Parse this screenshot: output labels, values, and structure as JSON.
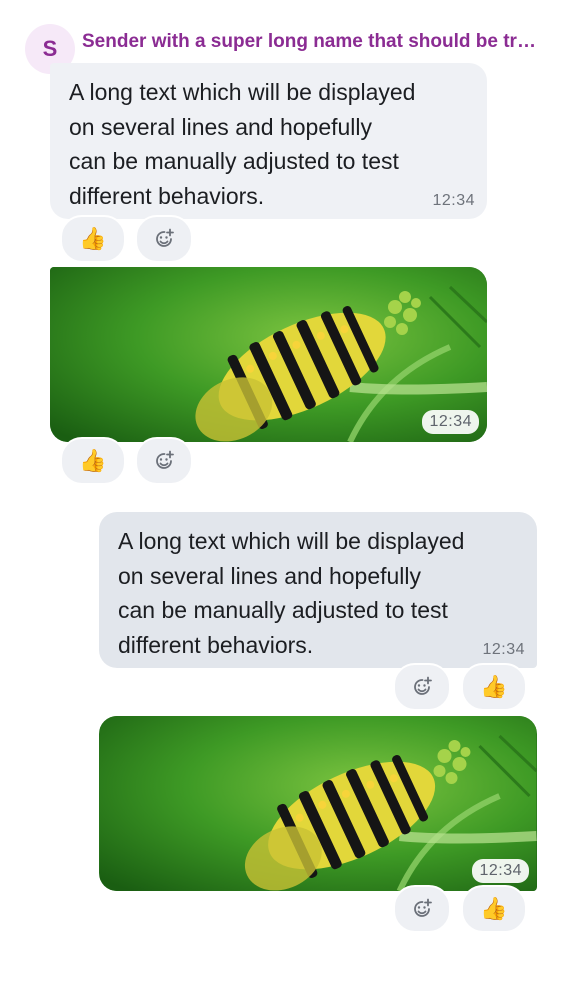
{
  "sender": {
    "initial": "S",
    "name": "Sender with a super long name that should be truncated"
  },
  "messages": [
    {
      "direction": "incoming",
      "type": "text",
      "lines": [
        "A long text which will be displayed",
        "on several lines and hopefully",
        "can be manually adjusted to test",
        "different behaviors."
      ],
      "time": "12:34",
      "reactions": [
        {
          "emoji": "👍"
        }
      ],
      "add_reaction_icon": "add-reaction-icon"
    },
    {
      "direction": "incoming",
      "type": "image",
      "image_subject": "caterpillar on plant",
      "time": "12:34",
      "reactions": [
        {
          "emoji": "👍"
        }
      ],
      "add_reaction_icon": "add-reaction-icon"
    },
    {
      "direction": "outgoing",
      "type": "text",
      "lines": [
        "A long text which will be displayed",
        "on several lines and hopefully",
        "can be manually adjusted to test",
        "different behaviors."
      ],
      "time": "12:34",
      "reactions": [
        {
          "emoji": "👍"
        }
      ],
      "add_reaction_icon": "add-reaction-icon"
    },
    {
      "direction": "outgoing",
      "type": "image",
      "image_subject": "caterpillar on plant",
      "time": "12:34",
      "reactions": [
        {
          "emoji": "👍"
        }
      ],
      "add_reaction_icon": "add-reaction-icon"
    }
  ],
  "colors": {
    "sender_name": "#8b2c93",
    "avatar_bg": "#f6e9f8",
    "incoming_bubble": "#eff1f5",
    "outgoing_bubble": "#e2e6ec",
    "timestamp": "#6e737b",
    "image_green": "#3f9b27"
  }
}
